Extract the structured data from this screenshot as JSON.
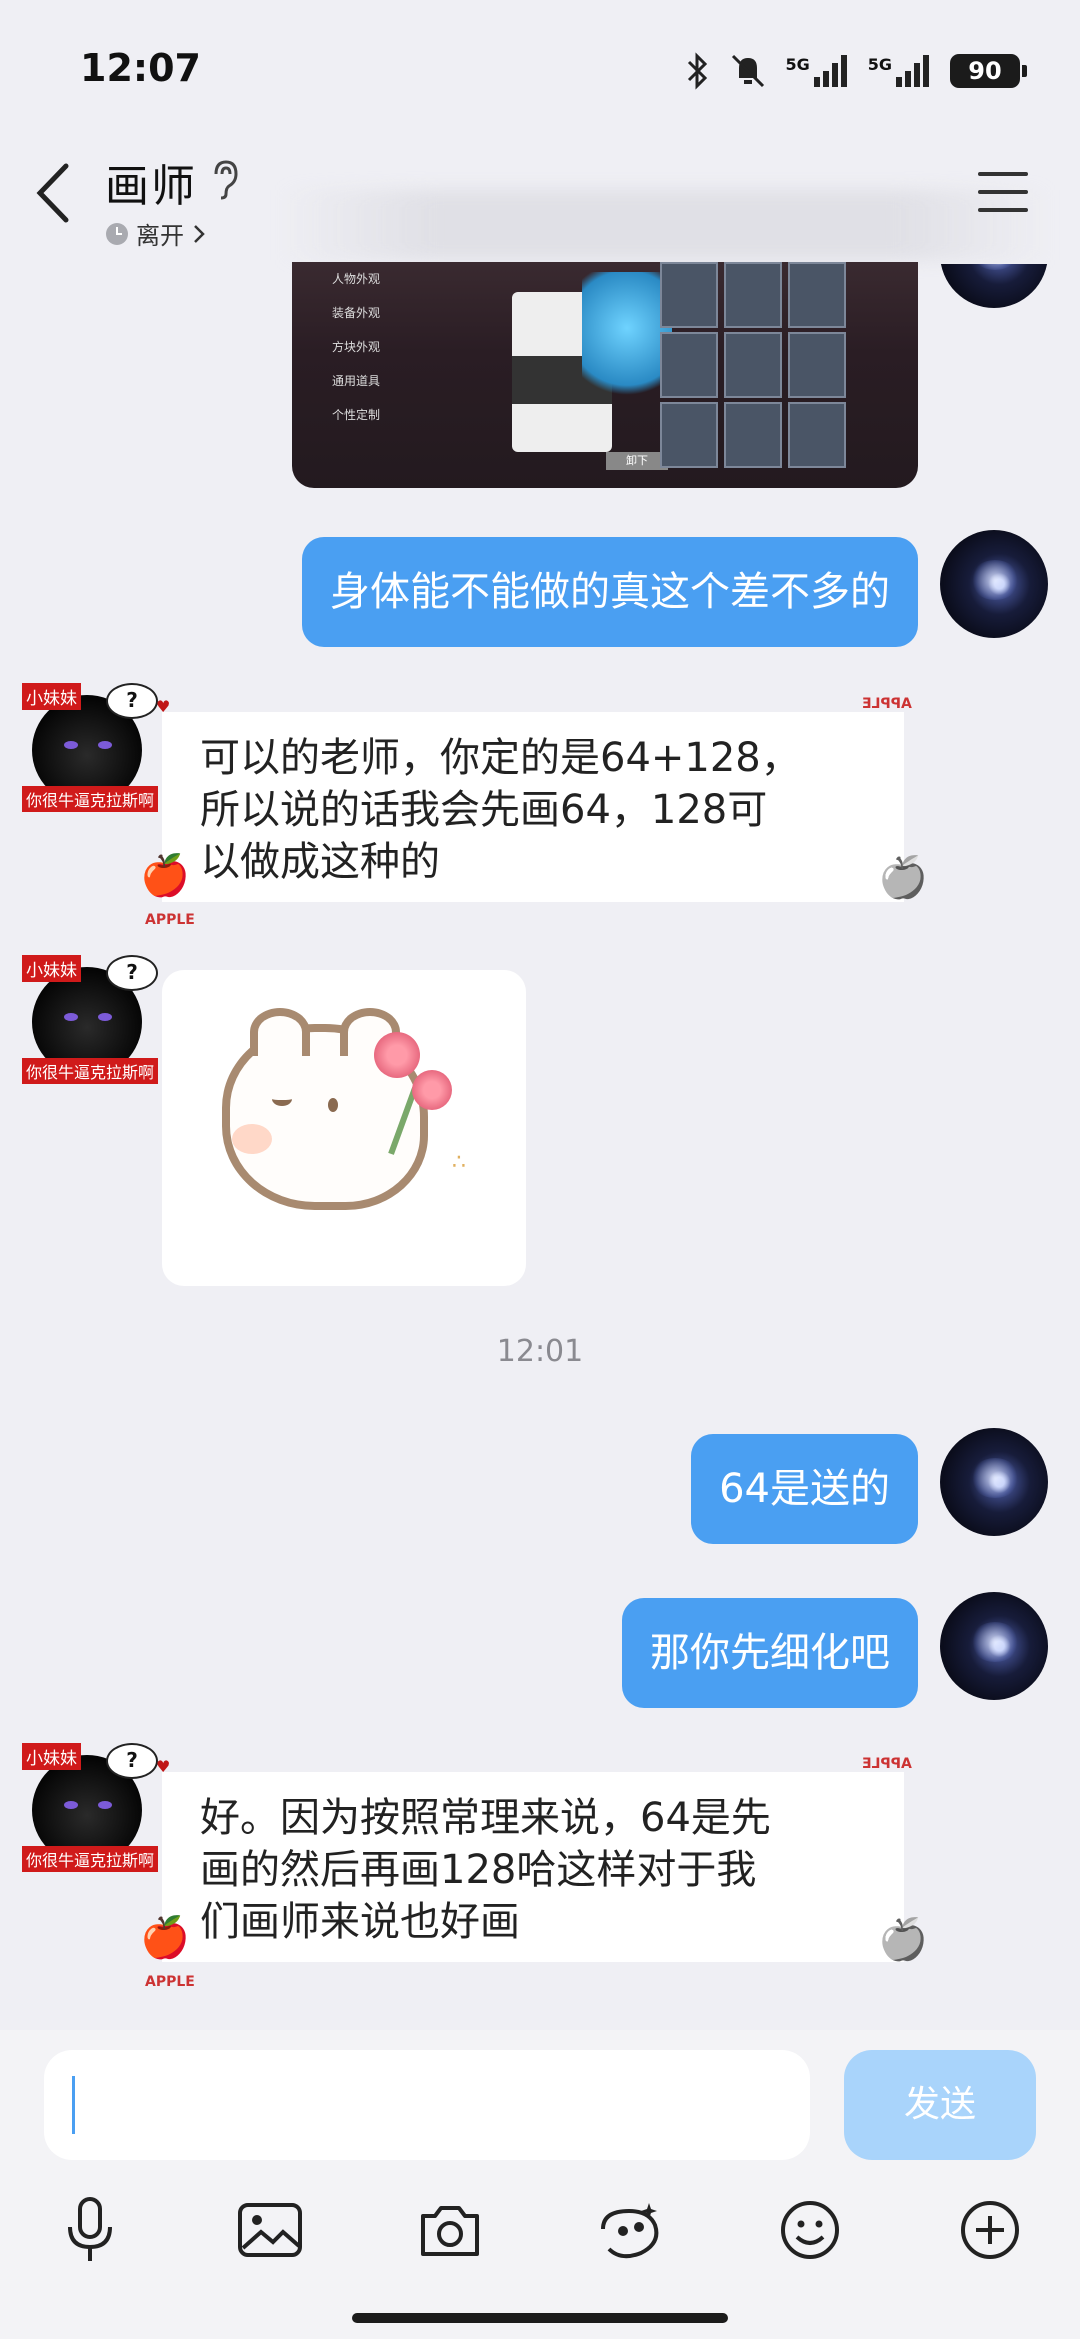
{
  "status_bar": {
    "time": "12:07",
    "net1": "5G",
    "net2": "5G",
    "battery": "90"
  },
  "header": {
    "title": "画师",
    "presence": "离开"
  },
  "messages": {
    "m1": "身体能不能做的真这个差不多的",
    "m2": [
      "可以的老师，你定的是64+128，",
      "所以说的话我会先画64，128可",
      "以做成这种的"
    ],
    "m3": "64是送的",
    "m4": "那你先细化吧",
    "m5": [
      "好。因为按照常理来说，64是先",
      "画的然后再画128哈这样对于我",
      "们画师来说也好画"
    ],
    "timestamp": "12:01"
  },
  "other_avatar": {
    "tag_top": "小妹妹",
    "tag_bottom": "你很牛逼克拉斯啊",
    "question": "?"
  },
  "bubble_deco": {
    "brand": "APPLE",
    "brand_flip": "APPLE"
  },
  "game_screenshot": {
    "menu": [
      "人物外观",
      "装备外观",
      "方块外观",
      "通用道具",
      "个性定制"
    ],
    "button": "卸下"
  },
  "input": {
    "placeholder": "",
    "send_label": "发送"
  },
  "toolbar": [
    "microphone-icon",
    "image-icon",
    "camera-icon",
    "sticker-icon",
    "emoji-icon",
    "plus-icon"
  ]
}
